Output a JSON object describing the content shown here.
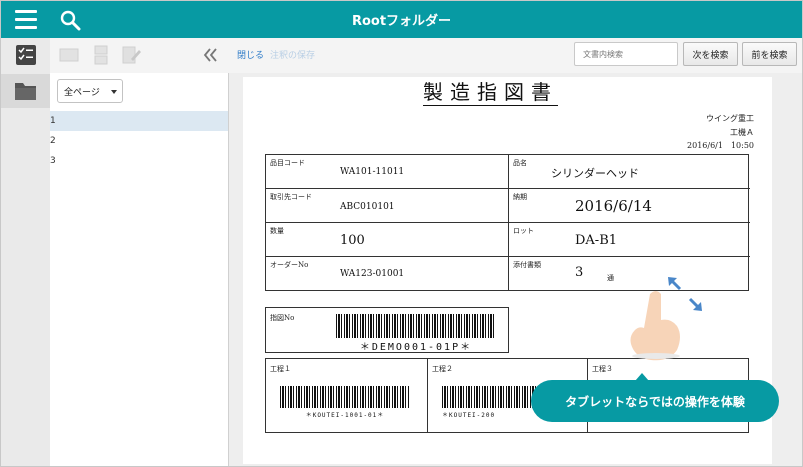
{
  "header": {
    "title": "Rootフォルダー"
  },
  "toolbar": {
    "close_label": "閉じる",
    "remove_label": "注釈の保存",
    "search_placeholder": "文書内検索",
    "next_label": "次を検索",
    "prev_label": "前を検索"
  },
  "pages": {
    "filter_value": "全ページ",
    "items": [
      "1",
      "2",
      "3"
    ]
  },
  "document": {
    "title": "製造指図書",
    "company": "ウイング重工",
    "division": "工機Ａ",
    "date": "2016/6/1　10:50",
    "fields": {
      "part_code_label": "品目コード",
      "part_code": "WA101-11011",
      "part_name_label": "品名",
      "part_name": "シリンダーヘッド",
      "client_code_label": "取引先コード",
      "client_code": "ABC010101",
      "due_label": "納期",
      "due": "2016/6/14",
      "qty_label": "数量",
      "qty": "100",
      "lot_label": "ロット",
      "lot": "DA-B1",
      "order_label": "オーダーNo",
      "order": "WA123-01001",
      "attach_label": "添付書類",
      "attach": "3",
      "attach_unit": "通"
    },
    "instruction_label": "指図No",
    "instruction_barcode": "＊DEMO001-01P＊",
    "process": [
      {
        "label": "工程１",
        "barcode": "＊KOUTEI-1001-01＊"
      },
      {
        "label": "工程２",
        "barcode": "＊KOUTEI-200"
      },
      {
        "label": "工程３",
        "barcode": ""
      }
    ]
  },
  "overlay": {
    "tooltip": "タブレットならではの操作を体験"
  },
  "colors": {
    "accent": "#079aa3",
    "link": "#2e7bc8"
  }
}
